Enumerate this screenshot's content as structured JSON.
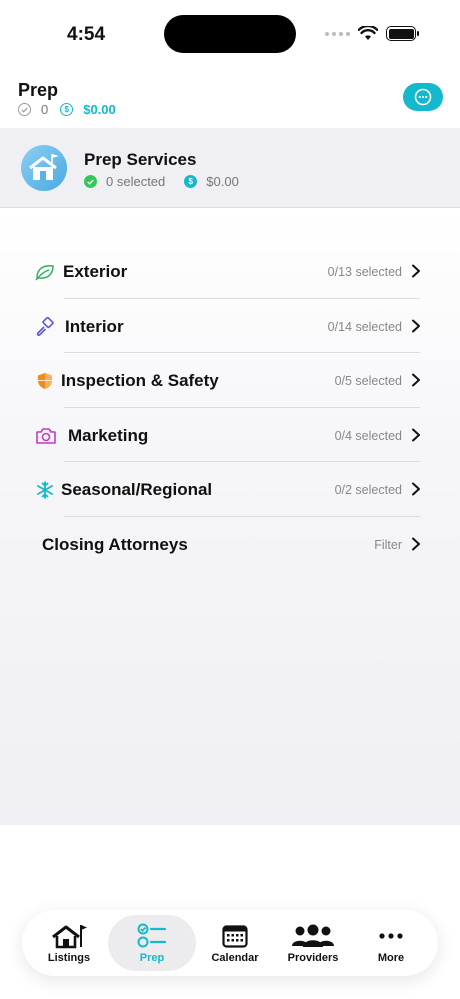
{
  "status_bar": {
    "time": "4:54"
  },
  "header": {
    "title": "Prep",
    "selected_count": "0",
    "total": "$0.00"
  },
  "services": {
    "title": "Prep Services",
    "selected_text": "0 selected",
    "total": "$0.00"
  },
  "categories": [
    {
      "label": "Exterior",
      "status": "0/13 selected",
      "icon": "leaf-icon",
      "color": "#3bb26a"
    },
    {
      "label": "Interior",
      "status": "0/14 selected",
      "icon": "paintbrush-icon",
      "color": "#5b55d6"
    },
    {
      "label": "Inspection & Safety",
      "status": "0/5 selected",
      "icon": "shield-icon",
      "color": "#f08a1c"
    },
    {
      "label": "Marketing",
      "status": "0/4 selected",
      "icon": "camera-icon",
      "color": "#c43ac9"
    },
    {
      "label": "Seasonal/Regional",
      "status": "0/2 selected",
      "icon": "snowflake-icon",
      "color": "#14b9cc"
    },
    {
      "label": "Closing Attorneys",
      "status": "Filter",
      "icon": "",
      "color": ""
    }
  ],
  "tabs": [
    {
      "label": "Listings",
      "icon": "house-flag-icon",
      "active": false
    },
    {
      "label": "Prep",
      "icon": "checklist-icon",
      "active": true
    },
    {
      "label": "Calendar",
      "icon": "calendar-icon",
      "active": false
    },
    {
      "label": "Providers",
      "icon": "people-icon",
      "active": false
    },
    {
      "label": "More",
      "icon": "ellipsis-icon",
      "active": false
    }
  ],
  "colors": {
    "accent": "#14b9cc",
    "success": "#34c759"
  }
}
